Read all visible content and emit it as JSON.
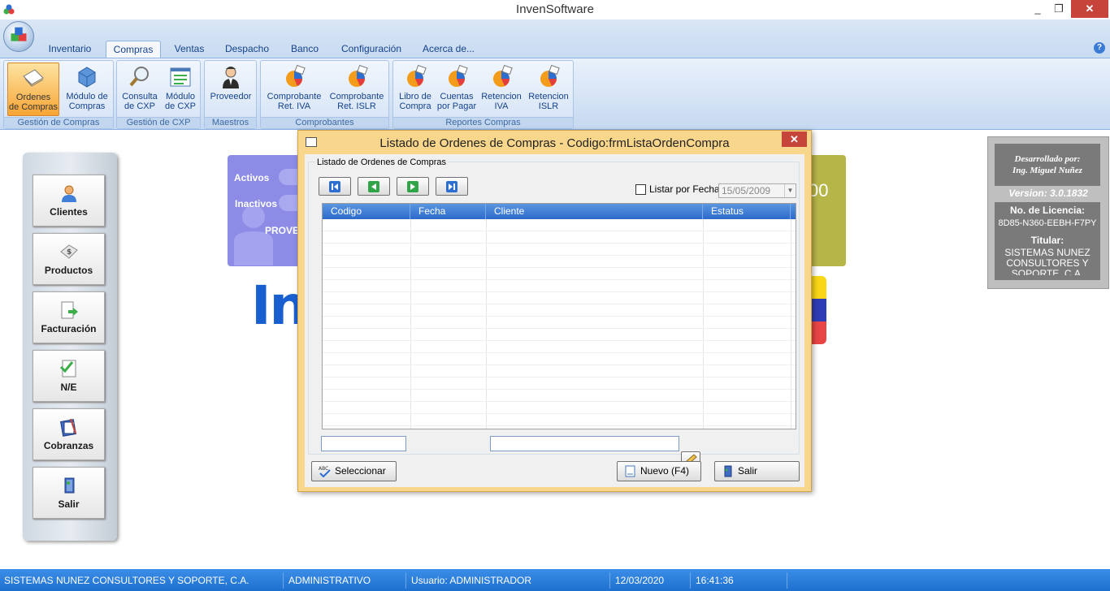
{
  "window": {
    "title": "InvenSoftware",
    "minimize": "_",
    "maximize": "❐",
    "close": "✕"
  },
  "ribbon_tabs": [
    {
      "label": "Inventario"
    },
    {
      "label": "Compras",
      "active": true
    },
    {
      "label": "Ventas"
    },
    {
      "label": "Despacho"
    },
    {
      "label": "Banco"
    },
    {
      "label": "Configuración"
    },
    {
      "label": "Acerca de..."
    }
  ],
  "help_icon": "?",
  "ribbon_groups": [
    {
      "label": "Gestión de Compras",
      "buttons": [
        {
          "label1": "Ordenes",
          "label2": "de Compras",
          "icon": "orders-icon",
          "active": true
        },
        {
          "label1": "Módulo de",
          "label2": "Compras",
          "icon": "module-icon"
        }
      ]
    },
    {
      "label": "Gestión de CXP",
      "buttons": [
        {
          "label1": "Consulta",
          "label2": "de CXP",
          "icon": "search-icon"
        },
        {
          "label1": "Módulo",
          "label2": "de CXP",
          "icon": "list-icon"
        }
      ]
    },
    {
      "label": "Maestros",
      "buttons": [
        {
          "label1": "Proveedor",
          "label2": "",
          "icon": "person-icon"
        }
      ]
    },
    {
      "label": "Comprobantes",
      "buttons": [
        {
          "label1": "Comprobante",
          "label2": "Ret. IVA",
          "icon": "report-icon"
        },
        {
          "label1": "Comprobante",
          "label2": "Ret. ISLR",
          "icon": "report-icon"
        }
      ]
    },
    {
      "label": "Reportes Compras",
      "buttons": [
        {
          "label1": "Libro de",
          "label2": "Compra",
          "icon": "report-icon"
        },
        {
          "label1": "Cuentas",
          "label2": "por Pagar",
          "icon": "report-icon"
        },
        {
          "label1": "Retencion",
          "label2": "IVA",
          "icon": "report-icon"
        },
        {
          "label1": "Retencion",
          "label2": "ISLR",
          "icon": "report-icon"
        }
      ]
    }
  ],
  "side_nav": [
    {
      "label": "Clientes",
      "icon": "user-icon"
    },
    {
      "label": "Productos",
      "icon": "tag-icon"
    },
    {
      "label": "Facturación",
      "icon": "invoice-icon"
    },
    {
      "label": "N/E",
      "icon": "check-doc-icon"
    },
    {
      "label": "Cobranzas",
      "icon": "notebook-icon"
    },
    {
      "label": "Salir",
      "icon": "exit-door-icon"
    }
  ],
  "dashboard": {
    "activos": "Activos",
    "inactivos": "Inactivos",
    "proveedores": "PROVE",
    "number_fragment": "00",
    "logo_fragment": "Inv"
  },
  "license": {
    "dev_line1": "Desarrollado por:",
    "dev_line2": "Ing. Miguel Nuñez",
    "version": "Version: 3.0.1832",
    "license_label": "No. de Licencia:",
    "license_number": "8D85-N360-EEBH-F7PY",
    "holder_label": "Titular:",
    "holder_line1": "SISTEMAS NUNEZ",
    "holder_line2": "CONSULTORES Y",
    "holder_line3": "SOPORTE, C.A."
  },
  "dialog": {
    "title": "Listado de Ordenes de Compras - Codigo:frmListaOrdenCompra",
    "close": "✕",
    "group_label": "Listado de Ordenes de Compras",
    "list_by_date_label": "Listar por Fecha",
    "list_by_date_checked": false,
    "date_value": "15/05/2009",
    "columns": [
      "Codigo",
      "Fecha",
      "Cliente",
      "Estatus"
    ],
    "rows": [],
    "filter_code_value": "",
    "filter_client_value": "",
    "buttons": {
      "select": "Seleccionar",
      "new": "Nuevo (F4)",
      "exit": "Salir"
    }
  },
  "status_bar": [
    "SISTEMAS NUNEZ CONSULTORES Y SOPORTE, C.A.",
    "ADMINISTRATIVO",
    "Usuario: ADMINISTRADOR",
    "12/03/2020",
    "16:41:36"
  ],
  "colors": {
    "ribbon_accent": "#15428b",
    "active_tab_orange": "#f8a535",
    "dialog_frame": "#f8d68b",
    "grid_header": "#2c6bcc",
    "statusbar": "#1e6fd0",
    "close_red": "#c7443a"
  }
}
